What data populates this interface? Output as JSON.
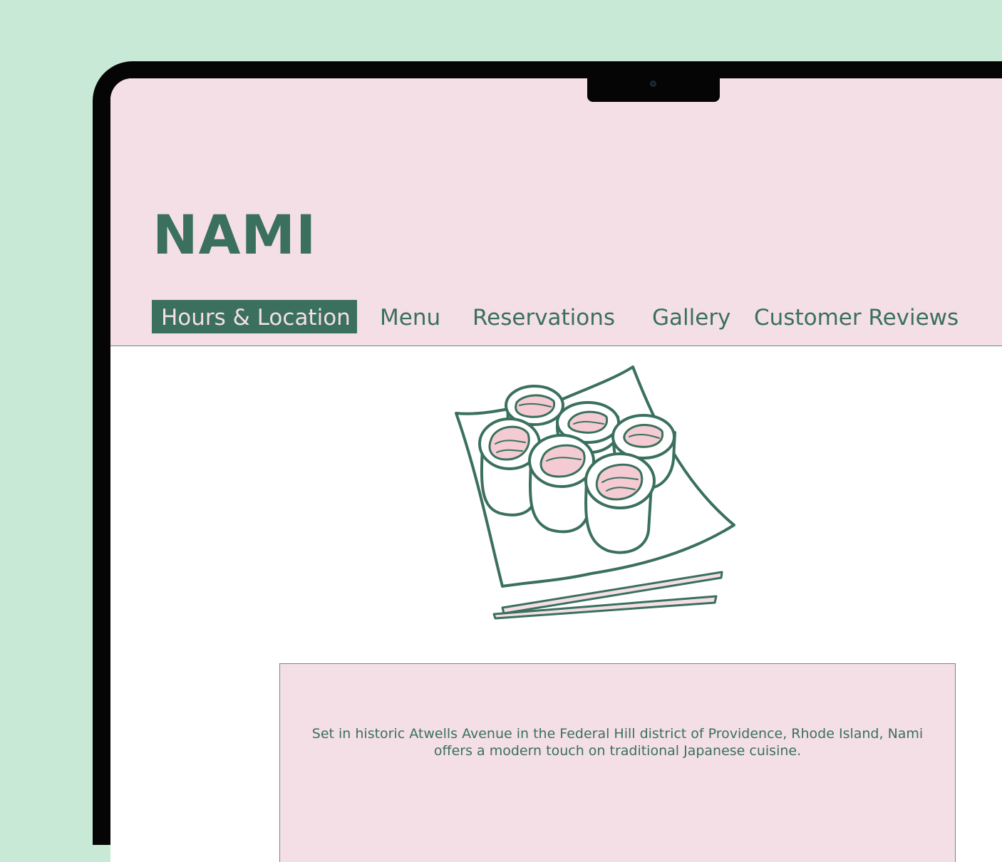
{
  "site": {
    "name": "NAMI"
  },
  "nav": {
    "items": [
      {
        "label": "Hours & Location",
        "active": true
      },
      {
        "label": "Menu",
        "active": false
      },
      {
        "label": "Reservations",
        "active": false
      },
      {
        "label": "Gallery",
        "active": false
      },
      {
        "label": "Customer Reviews",
        "active": false
      }
    ]
  },
  "hero": {
    "illustration": "sushi-plate-with-chopsticks"
  },
  "about": {
    "text": "Set in historic Atwells Avenue in the Federal Hill district of Providence, Rhode Island, Nami offers a modern touch on traditional Japanese cuisine."
  },
  "colors": {
    "page_background": "#c8e9d6",
    "header_background": "#f4dfe6",
    "brand_green": "#3a705d",
    "bezel": "#050505"
  }
}
